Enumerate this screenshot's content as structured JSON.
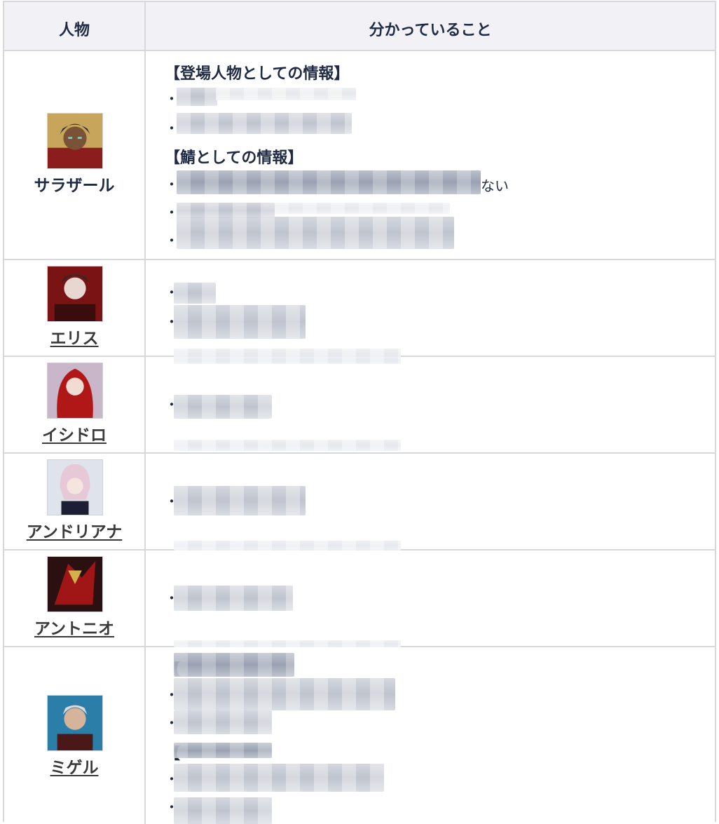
{
  "header": {
    "col_person": "人物",
    "col_known": "分かっていること"
  },
  "rows": [
    {
      "name": "サラザール",
      "section1": "【登場人物としての情報】",
      "section2": "【鯖としての情報】",
      "trail": "ない"
    },
    {
      "name": "エリス"
    },
    {
      "name": "イシドロ"
    },
    {
      "name": "アンドリアナ"
    },
    {
      "name": "アントニオ"
    },
    {
      "name": "ミゲル",
      "section_marker": "【"
    }
  ],
  "bullet": "・",
  "colors": {
    "border": "#d6d8dc",
    "header_bg": "#f2f2f6",
    "text": "#1f2a44"
  }
}
